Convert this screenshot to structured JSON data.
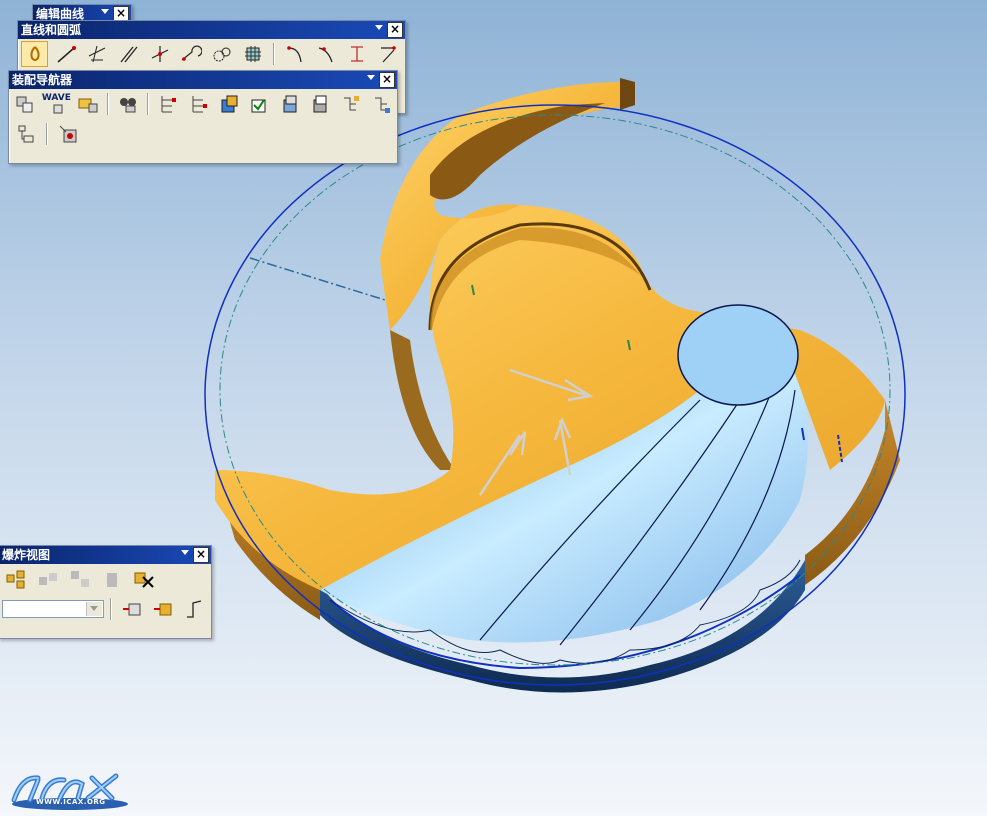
{
  "toolbars": {
    "edit_curve": {
      "title": "编辑曲线"
    },
    "lines_arcs": {
      "title": "直线和圆弧"
    },
    "assembly_navigator": {
      "title": "装配导航器",
      "wave_label": "WAVE"
    },
    "exploded_view": {
      "title": "爆炸视图",
      "select_value": ""
    }
  },
  "logo": {
    "text": "WWW.ICAX.ORG"
  },
  "colors": {
    "part_gold": "#f5b73c",
    "part_blue": "#9fd0f5",
    "edge_blue": "#1030c0",
    "title_bar": "#0a246a"
  },
  "icons": [
    "point-icon",
    "line-icon",
    "line-point-icon",
    "line-parallel-icon",
    "line-tangent-icon",
    "arc-icon",
    "arc-tangent-icon",
    "grid-icon",
    "fillet-icon",
    "spline-icon",
    "bracket-icon",
    "corner-icon",
    "component-icon",
    "folder-icon",
    "binoculars-icon",
    "tree-icon",
    "check-icon",
    "explode-icon",
    "unexplode-icon",
    "trace-line-icon"
  ]
}
